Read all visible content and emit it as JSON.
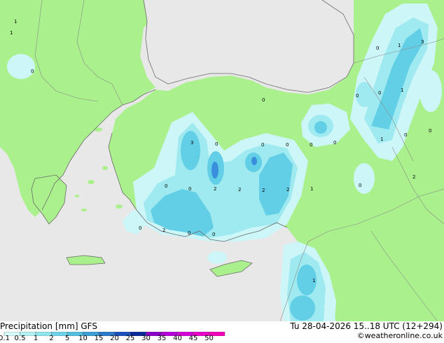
{
  "footer": {
    "title": "Precipitation [mm]  GFS",
    "run": "Tu 28-04-2026 15..18 UTC (12+294)",
    "credit": "©weatheronline.co.uk"
  },
  "legend": {
    "ticks": [
      "0.1",
      "0.5",
      "1",
      "2",
      "5",
      "10",
      "15",
      "20",
      "25",
      "30",
      "35",
      "40",
      "45",
      "50"
    ],
    "colors": [
      "#d5fbfb",
      "#b3f2f4",
      "#8fe5ee",
      "#6ed3e8",
      "#52bfe0",
      "#3a9fd6",
      "#2a78cc",
      "#1a4fbd",
      "#0a2a9a",
      "#8a00c8",
      "#b400d8",
      "#d400d8",
      "#e600c8",
      "#f000b8"
    ]
  },
  "map": {
    "colors": {
      "sea": "#e8e8e8",
      "land": "#aaf08c",
      "precip_light": "#cdf6f8",
      "precip_mid": "#9eeaf0",
      "precip_heavy": "#62cfe6",
      "precip_peak": "#3a8fdc"
    },
    "value_labels": [
      "1",
      "0",
      "0",
      "3",
      "0",
      "0",
      "0",
      "0",
      "0",
      "2",
      "0",
      "2",
      "2",
      "2",
      "1",
      "0",
      "0",
      "2",
      "0",
      "1",
      "0",
      "1",
      "0",
      "2",
      "3",
      "0",
      "1",
      "0",
      "1",
      "0",
      "0",
      "0",
      "1"
    ]
  }
}
